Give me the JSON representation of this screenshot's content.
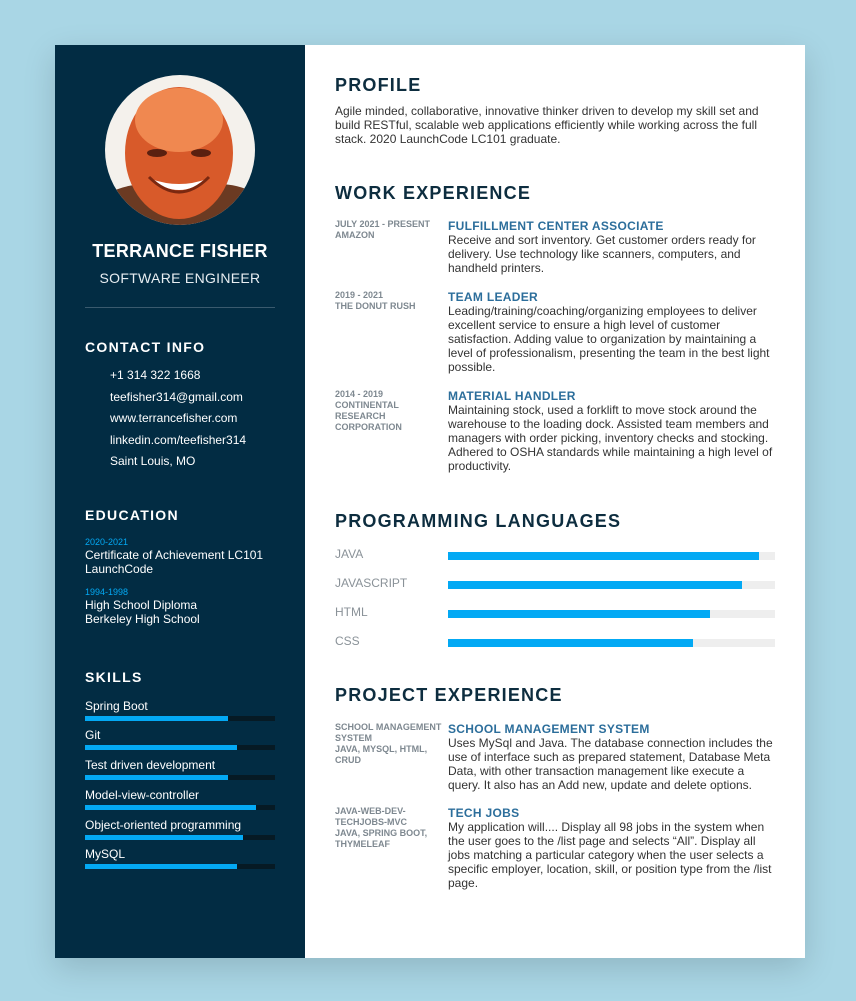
{
  "sidebar": {
    "name": "TERRANCE FISHER",
    "role": "SOFTWARE ENGINEER",
    "contact_heading": "CONTACT INFO",
    "contact": [
      "+1 314 322 1668",
      "teefisher314@gmail.com",
      "www.terrancefisher.com",
      "linkedin.com/teefisher314",
      "Saint Louis, MO"
    ],
    "education_heading": "EDUCATION",
    "education": [
      {
        "years": "2020-2021",
        "lines": [
          "Certificate of Achievement LC101",
          "LaunchCode"
        ]
      },
      {
        "years": "1994-1998",
        "lines": [
          "High School Diploma",
          "Berkeley High School"
        ]
      }
    ],
    "skills_heading": "SKILLS",
    "skills": [
      {
        "name": "Spring Boot",
        "level": 0.75
      },
      {
        "name": "Git",
        "level": 0.8
      },
      {
        "name": "Test driven development",
        "level": 0.75
      },
      {
        "name": "Model-view-controller",
        "level": 0.9
      },
      {
        "name": "Object-oriented programming",
        "level": 0.83
      },
      {
        "name": "MySQL",
        "level": 0.8
      }
    ]
  },
  "main": {
    "profile_heading": "PROFILE",
    "profile_text": "Agile minded, collaborative, innovative thinker driven to develop my skill set and build RESTful, scalable web applications efficiently while working across the full stack. 2020 LaunchCode LC101 graduate.",
    "work_heading": "WORK EXPERIENCE",
    "work": [
      {
        "period": "JULY 2021 - PRESENT",
        "org": "AMAZON",
        "title": "FULFILLMENT CENTER ASSOCIATE",
        "desc": "Receive and sort inventory. Get customer orders ready for delivery. Use technology like scanners, computers, and handheld printers."
      },
      {
        "period": "2019 - 2021",
        "org": "THE DONUT RUSH",
        "title": "TEAM LEADER",
        "desc": "Leading/training/coaching/organizing employees to deliver excellent service to ensure a high level of customer satisfaction. Adding value to organization by maintaining a level of professionalism, presenting the team in the best light possible."
      },
      {
        "period": "2014 - 2019",
        "org": "CONTINENTAL RESEARCH CORPORATION",
        "title": "MATERIAL HANDLER",
        "desc": "Maintaining stock, used a forklift to move stock around the warehouse to the loading dock. Assisted team members and managers with order picking, inventory checks and stocking. Adhered to OSHA standards while maintaining a high level of productivity."
      }
    ],
    "languages_heading": "PROGRAMMING LANGUAGES",
    "languages": [
      {
        "name": "JAVA",
        "level": 0.95
      },
      {
        "name": "JAVASCRIPT",
        "level": 0.9
      },
      {
        "name": "HTML",
        "level": 0.8
      },
      {
        "name": "CSS",
        "level": 0.75
      }
    ],
    "projects_heading": "PROJECT EXPERIENCE",
    "projects": [
      {
        "name": "SCHOOL MANAGEMENT SYSTEM",
        "stack": "JAVA, MYSQL, HTML, CRUD",
        "title": "SCHOOL MANAGEMENT SYSTEM",
        "desc": "Uses MySql and Java. The database connection includes the use of interface such as prepared statement, Database Meta Data, with other transaction management like execute a query. It also has an Add new, update and delete options."
      },
      {
        "name": "JAVA-WEB-DEV-TECHJOBS-MVC",
        "stack": "JAVA, SPRING BOOT, THYMELEAF",
        "title": "TECH JOBS",
        "desc": "My application will.... Display all 98 jobs in the system when the user goes to the /list page and selects “All”. Display all jobs matching a particular category when the user selects a specific employer, location, skill, or position type from the /list page."
      }
    ]
  }
}
